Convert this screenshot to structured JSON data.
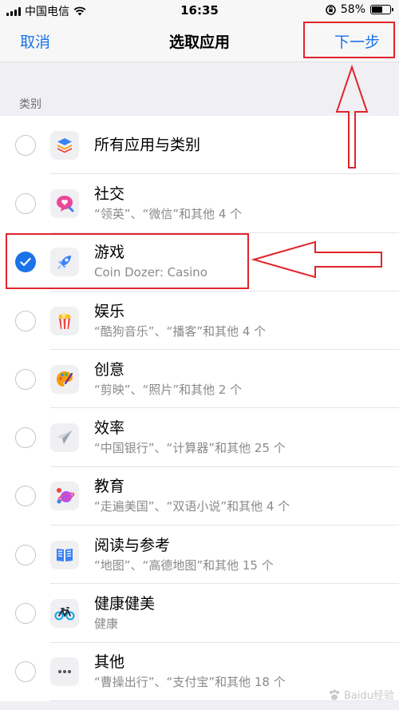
{
  "status_bar": {
    "carrier": "中国电信",
    "time": "16:35",
    "battery": "58%",
    "battery_level": 0.58
  },
  "nav": {
    "cancel_label": "取消",
    "title": "选取应用",
    "next_label": "下一步"
  },
  "section_label": "类别",
  "categories": [
    {
      "name": "所有应用与类别",
      "subtitle": "",
      "icon": "layers-icon",
      "checked": false
    },
    {
      "name": "社交",
      "subtitle": "“领英”、“微信”和其他 4 个",
      "icon": "chat-heart-icon",
      "checked": false
    },
    {
      "name": "游戏",
      "subtitle": "Coin Dozer: Casino",
      "icon": "rocket-icon",
      "checked": true
    },
    {
      "name": "娱乐",
      "subtitle": "“酷狗音乐”、“播客”和其他 4 个",
      "icon": "popcorn-icon",
      "checked": false
    },
    {
      "name": "创意",
      "subtitle": "“剪映”、“照片”和其他 2 个",
      "icon": "palette-icon",
      "checked": false
    },
    {
      "name": "效率",
      "subtitle": "“中国银行”、“计算器”和其他 25 个",
      "icon": "paper-plane-icon",
      "checked": false
    },
    {
      "name": "教育",
      "subtitle": "“走遍美国”、“双语小说”和其他 4 个",
      "icon": "planet-icon",
      "checked": false
    },
    {
      "name": "阅读与参考",
      "subtitle": "“地图”、“高德地图”和其他 15 个",
      "icon": "book-icon",
      "checked": false
    },
    {
      "name": "健康健美",
      "subtitle": "健康",
      "icon": "bicycle-icon",
      "checked": false
    },
    {
      "name": "其他",
      "subtitle": "“曹操出行”、“支付宝”和其他 18 个",
      "icon": "more-dots-icon",
      "checked": false
    }
  ],
  "watermark": "Baidu经验",
  "colors": {
    "accent": "#1a73e8",
    "annotation_red": "#e0242b"
  }
}
